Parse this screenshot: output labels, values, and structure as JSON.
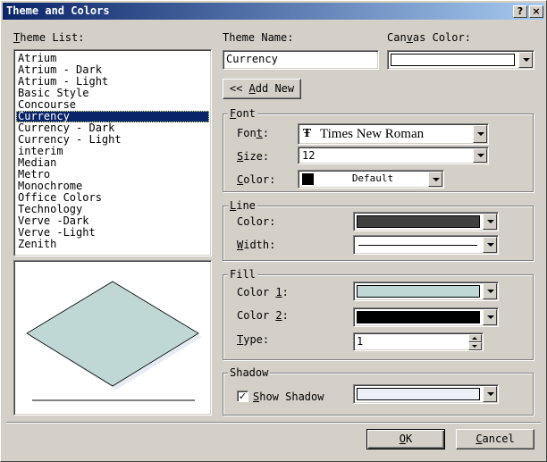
{
  "window": {
    "title": "Theme and Colors",
    "help_glyph": "?",
    "close_glyph": "×"
  },
  "theme_list": {
    "label_u": "T",
    "label_rest": "heme List:",
    "items": [
      "Atrium",
      "Atrium - Dark",
      "Atrium - Light",
      "Basic Style",
      "Concourse",
      "Currency",
      "Currency - Dark",
      "Currency - Light",
      "interim",
      "Median",
      "Metro",
      "Monochrome",
      "Office Colors",
      "Technology",
      "Verve -Dark",
      "Verve -Light",
      "Zenith"
    ],
    "selected_index": 5
  },
  "theme_name": {
    "label": "Theme Name:",
    "value": "Currency"
  },
  "canvas_color": {
    "label_pre": "Can",
    "label_u": "v",
    "label_post": "as Color:",
    "color": "#ffffff"
  },
  "add_new": {
    "prefix": "<< ",
    "u": "A",
    "rest": "dd New"
  },
  "font_group": {
    "title_u": "F",
    "title_rest": "ont",
    "font_label_pre": "Fon",
    "font_label_u": "t",
    "font_label_post": ":",
    "font_icon": "Ŧ",
    "font_value": "Times New Roman",
    "size_label_u": "S",
    "size_label_rest": "ize:",
    "size_value": "12",
    "color_label_u": "C",
    "color_label_rest": "olor:",
    "color_value": "Default",
    "color_swatch": "#000000"
  },
  "line_group": {
    "title_u": "L",
    "title_rest": "ine",
    "color_label": "Color:",
    "color_swatch": "#404040",
    "width_label_u": "W",
    "width_label_rest": "idth:"
  },
  "fill_group": {
    "title": "Fill",
    "color1_label_pre": "Color ",
    "color1_label_u": "1",
    "color1_label_post": ":",
    "color1_swatch": "#bfd8d5",
    "color2_label_pre": "Color ",
    "color2_label_u": "2",
    "color2_label_post": ":",
    "color2_swatch": "#000000",
    "type_label_u": "T",
    "type_label_rest": "ype:",
    "type_value": "1"
  },
  "shadow_group": {
    "title": "Shadow",
    "checked": true,
    "check_glyph": "✓",
    "show_label_u": "S",
    "show_label_rest": "how Shadow",
    "color_swatch": "#eef0f8"
  },
  "preview": {
    "fill": "#bfd8d5",
    "shadow": "#e6ecf5"
  },
  "buttons": {
    "ok_u": "O",
    "ok_rest": "K",
    "cancel_u": "C",
    "cancel_rest": "ancel"
  }
}
